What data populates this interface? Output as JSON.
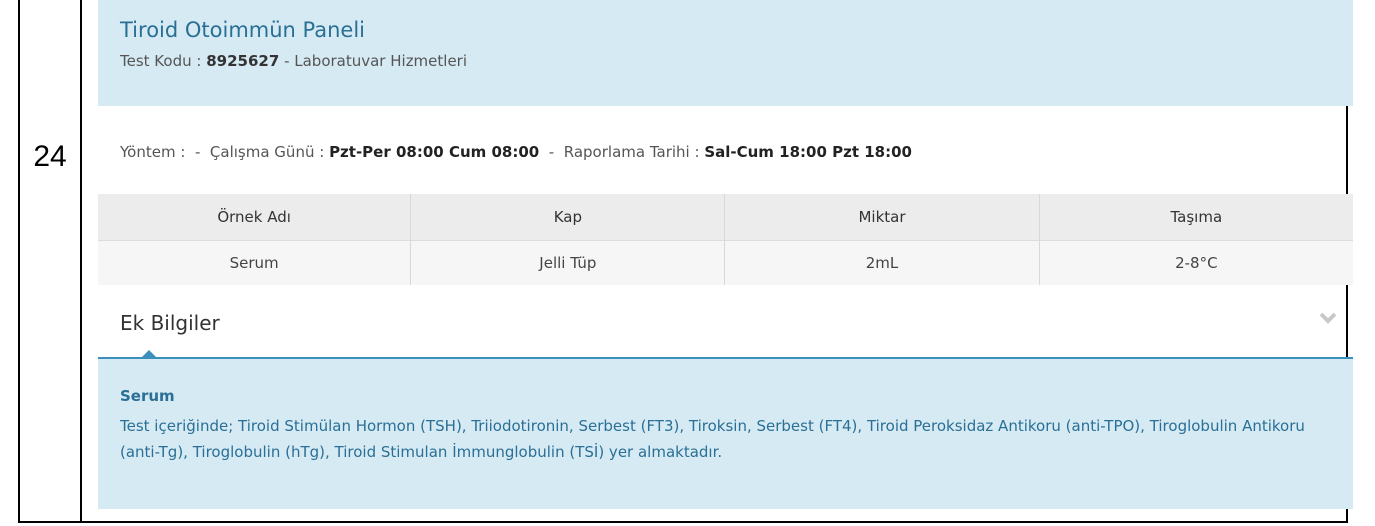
{
  "row_number": "24",
  "header": {
    "title": "Tiroid Otoimmün Paneli",
    "code_label": "Test Kodu :",
    "code_value": "8925627",
    "code_suffix": "- Laboratuvar Hizmetleri"
  },
  "meta": {
    "method_label": "Yöntem :",
    "sep1": "-",
    "work_label": "Çalışma Günü :",
    "work_value": "Pzt-Per 08:00 Cum 08:00",
    "sep2": "-",
    "report_label": "Raporlama Tarihi :",
    "report_value": "Sal-Cum 18:00 Pzt 18:00"
  },
  "table": {
    "headers": [
      "Örnek Adı",
      "Kap",
      "Miktar",
      "Taşıma"
    ],
    "rows": [
      [
        "Serum",
        "Jelli Tüp",
        "2mL",
        "2-8°C"
      ]
    ]
  },
  "ek_bilgiler": {
    "title": "Ek Bilgiler",
    "subtitle": "Serum",
    "text": "Test içeriğinde; Tiroid Stimülan Hormon (TSH), Triiodotironin, Serbest (FT3), Tiroksin, Serbest (FT4), Tiroid Peroksidaz Antikoru (anti-TPO), Tiroglobulin Antikoru (anti-Tg), Tiroglobulin (hTg), Tiroid Stimulan İmmunglobulin (TSİ) yer almaktadır."
  }
}
